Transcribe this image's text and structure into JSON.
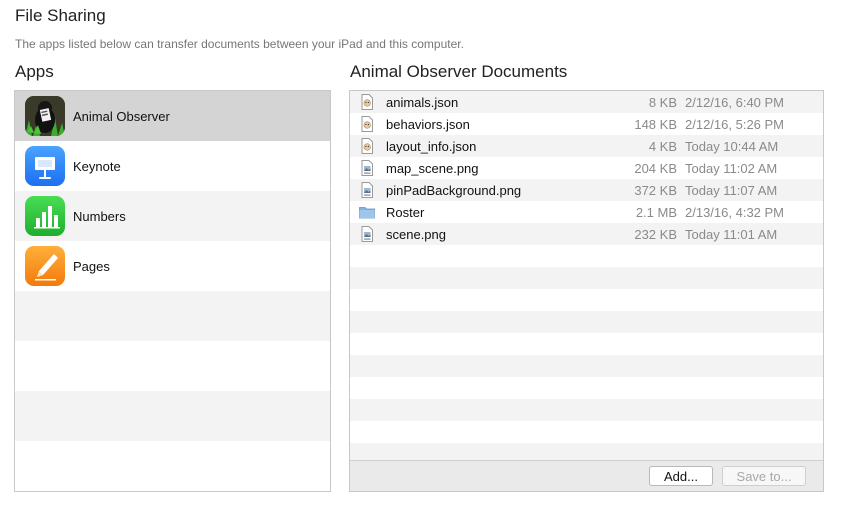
{
  "header": {
    "title": "File Sharing",
    "subtitle": "The apps listed below can transfer documents between your iPad and this computer."
  },
  "apps": {
    "label": "Apps",
    "items": [
      {
        "name": "Animal Observer",
        "icon": "animal-observer-app-icon",
        "selected": true
      },
      {
        "name": "Keynote",
        "icon": "keynote-app-icon",
        "selected": false
      },
      {
        "name": "Numbers",
        "icon": "numbers-app-icon",
        "selected": false
      },
      {
        "name": "Pages",
        "icon": "pages-app-icon",
        "selected": false
      }
    ]
  },
  "documents": {
    "label": "Animal Observer Documents",
    "items": [
      {
        "name": "animals.json",
        "size": "8 KB",
        "date": "2/12/16, 6:40 PM",
        "icon": "json-file-icon"
      },
      {
        "name": "behaviors.json",
        "size": "148 KB",
        "date": "2/12/16, 5:26 PM",
        "icon": "json-file-icon"
      },
      {
        "name": "layout_info.json",
        "size": "4 KB",
        "date": "Today 10:44 AM",
        "icon": "json-file-icon"
      },
      {
        "name": "map_scene.png",
        "size": "204 KB",
        "date": "Today 11:02 AM",
        "icon": "png-file-icon"
      },
      {
        "name": "pinPadBackground.png",
        "size": "372 KB",
        "date": "Today 11:07 AM",
        "icon": "png-file-icon"
      },
      {
        "name": "Roster",
        "size": "2.1 MB",
        "date": "2/13/16, 4:32 PM",
        "icon": "folder-icon"
      },
      {
        "name": "scene.png",
        "size": "232 KB",
        "date": "Today 11:01 AM",
        "icon": "png-file-icon"
      }
    ],
    "buttons": {
      "add": "Add...",
      "save": "Save to..."
    }
  },
  "colors": {
    "selected_row": "#d4d4d4",
    "alt_row": "#f3f3f3",
    "keynote": "#2f86f5",
    "numbers": "#2fc43b",
    "pages": "#f6901e",
    "folder": "#7fb3e0"
  }
}
